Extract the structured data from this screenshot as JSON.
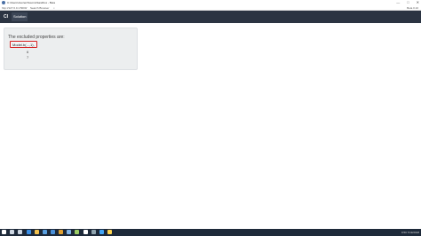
{
  "window": {
    "title": "C:\\Users\\Jouzen\\Source\\Sandbox - Beta",
    "controls": [
      "—",
      "□",
      "✕"
    ]
  },
  "address_bar": {
    "url": "http://127.0.0.1:5000/",
    "search_placeholder": "Search Browser",
    "search_button": "⌕",
    "right_info": "Beta 0.10"
  },
  "navbar": {
    "brand": "CI",
    "link": "Solution"
  },
  "main": {
    "heading": "The excluded properties are:",
    "highlighted_item": "Model.b(...,1),",
    "items": [
      "6",
      "7"
    ]
  },
  "taskbar": {
    "icons": [
      {
        "name": "start-icon",
        "color": "#ffffff"
      },
      {
        "name": "search-icon",
        "color": "#cfd8e3"
      },
      {
        "name": "task-view-icon",
        "color": "#cfd8e3"
      },
      {
        "name": "edge-icon",
        "color": "#3a8ee6"
      },
      {
        "name": "explorer-icon",
        "color": "#f2c14e"
      },
      {
        "name": "store-icon",
        "color": "#5aa0e0"
      },
      {
        "name": "mail-icon",
        "color": "#4a90d9"
      },
      {
        "name": "app-icon-1",
        "color": "#e0a030"
      },
      {
        "name": "app-icon-2",
        "color": "#7fb3e8"
      },
      {
        "name": "app-icon-3",
        "color": "#9ccc65"
      },
      {
        "name": "app-icon-4",
        "color": "#ffffff"
      },
      {
        "name": "app-icon-5",
        "color": "#90a4ae"
      },
      {
        "name": "app-icon-6",
        "color": "#42a5f5"
      },
      {
        "name": "app-icon-7",
        "color": "#ffd54f"
      }
    ],
    "time": "9:50",
    "date": "7/19/2018"
  }
}
